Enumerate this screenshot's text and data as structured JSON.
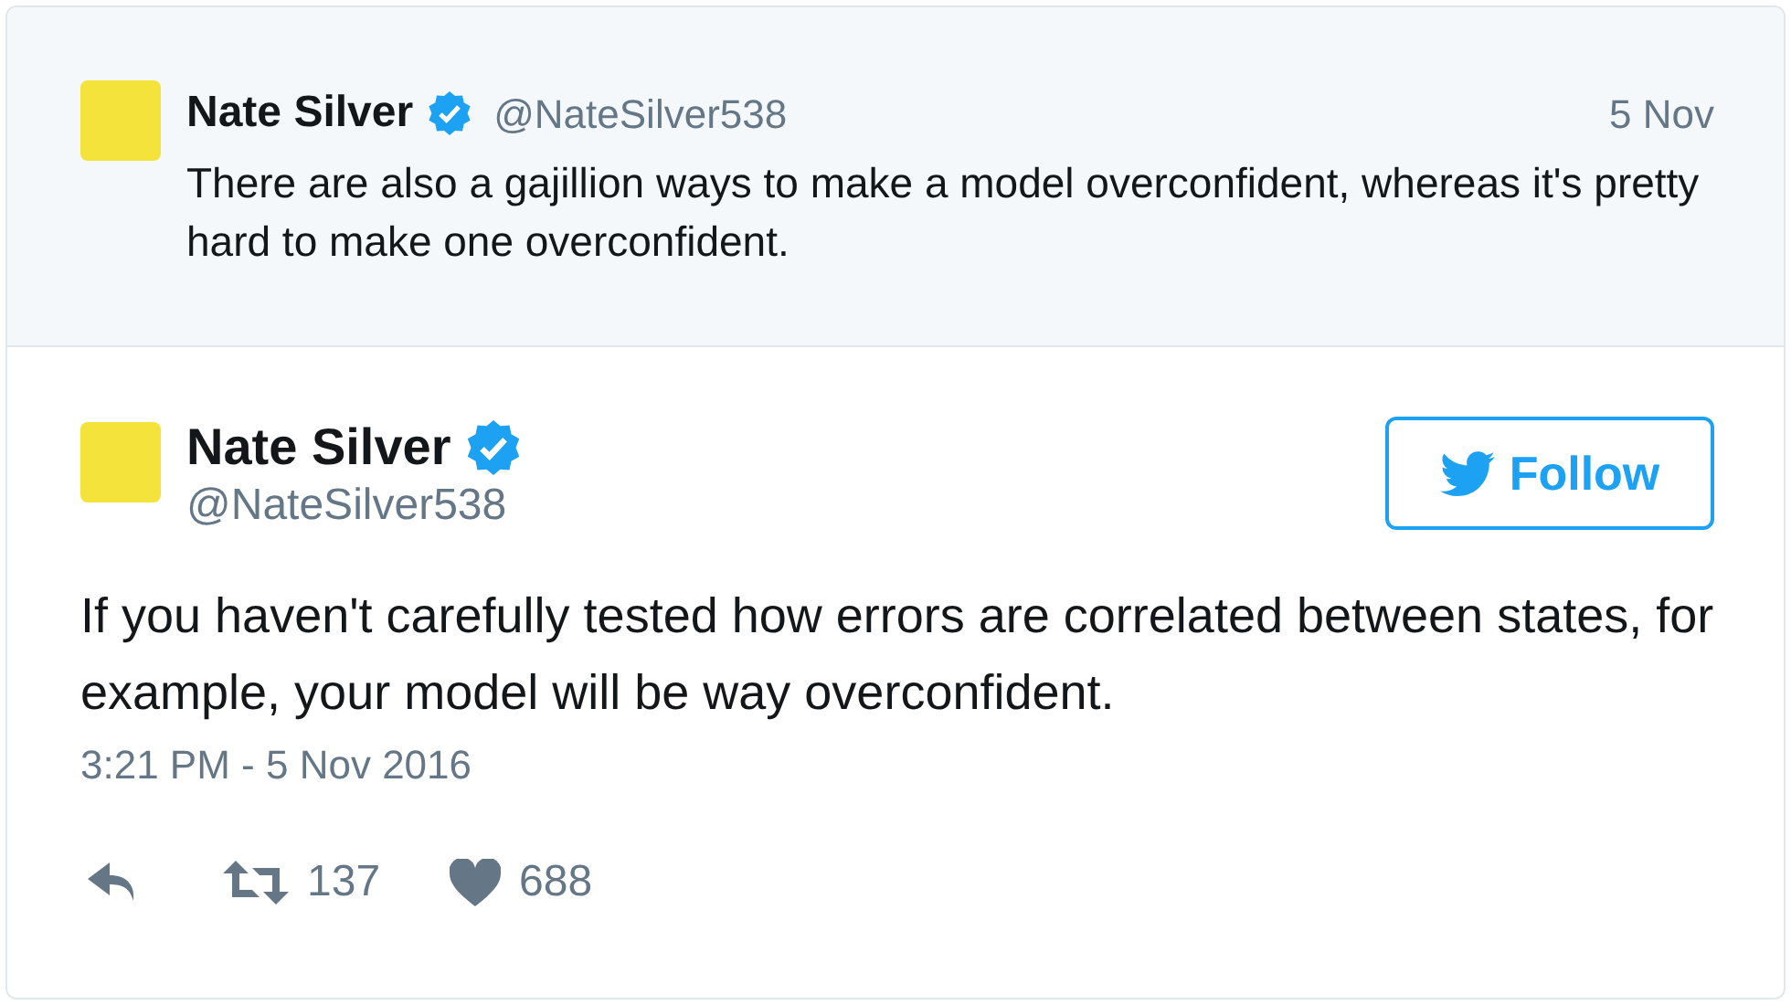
{
  "parent_tweet": {
    "name": "Nate Silver",
    "verified": true,
    "handle": "@NateSilver538",
    "date": "5 Nov",
    "text": "There are also a gajillion ways to make a model overconfident, whereas it's pretty hard to make one overconfident."
  },
  "tweet": {
    "name": "Nate Silver",
    "verified": true,
    "handle": "@NateSilver538",
    "follow_label": "Follow",
    "text": "If you haven't carefully tested how errors are correlated between states, for example, your model will be way overconfident.",
    "timestamp": "3:21 PM - 5 Nov 2016",
    "retweets": "137",
    "likes": "688"
  }
}
